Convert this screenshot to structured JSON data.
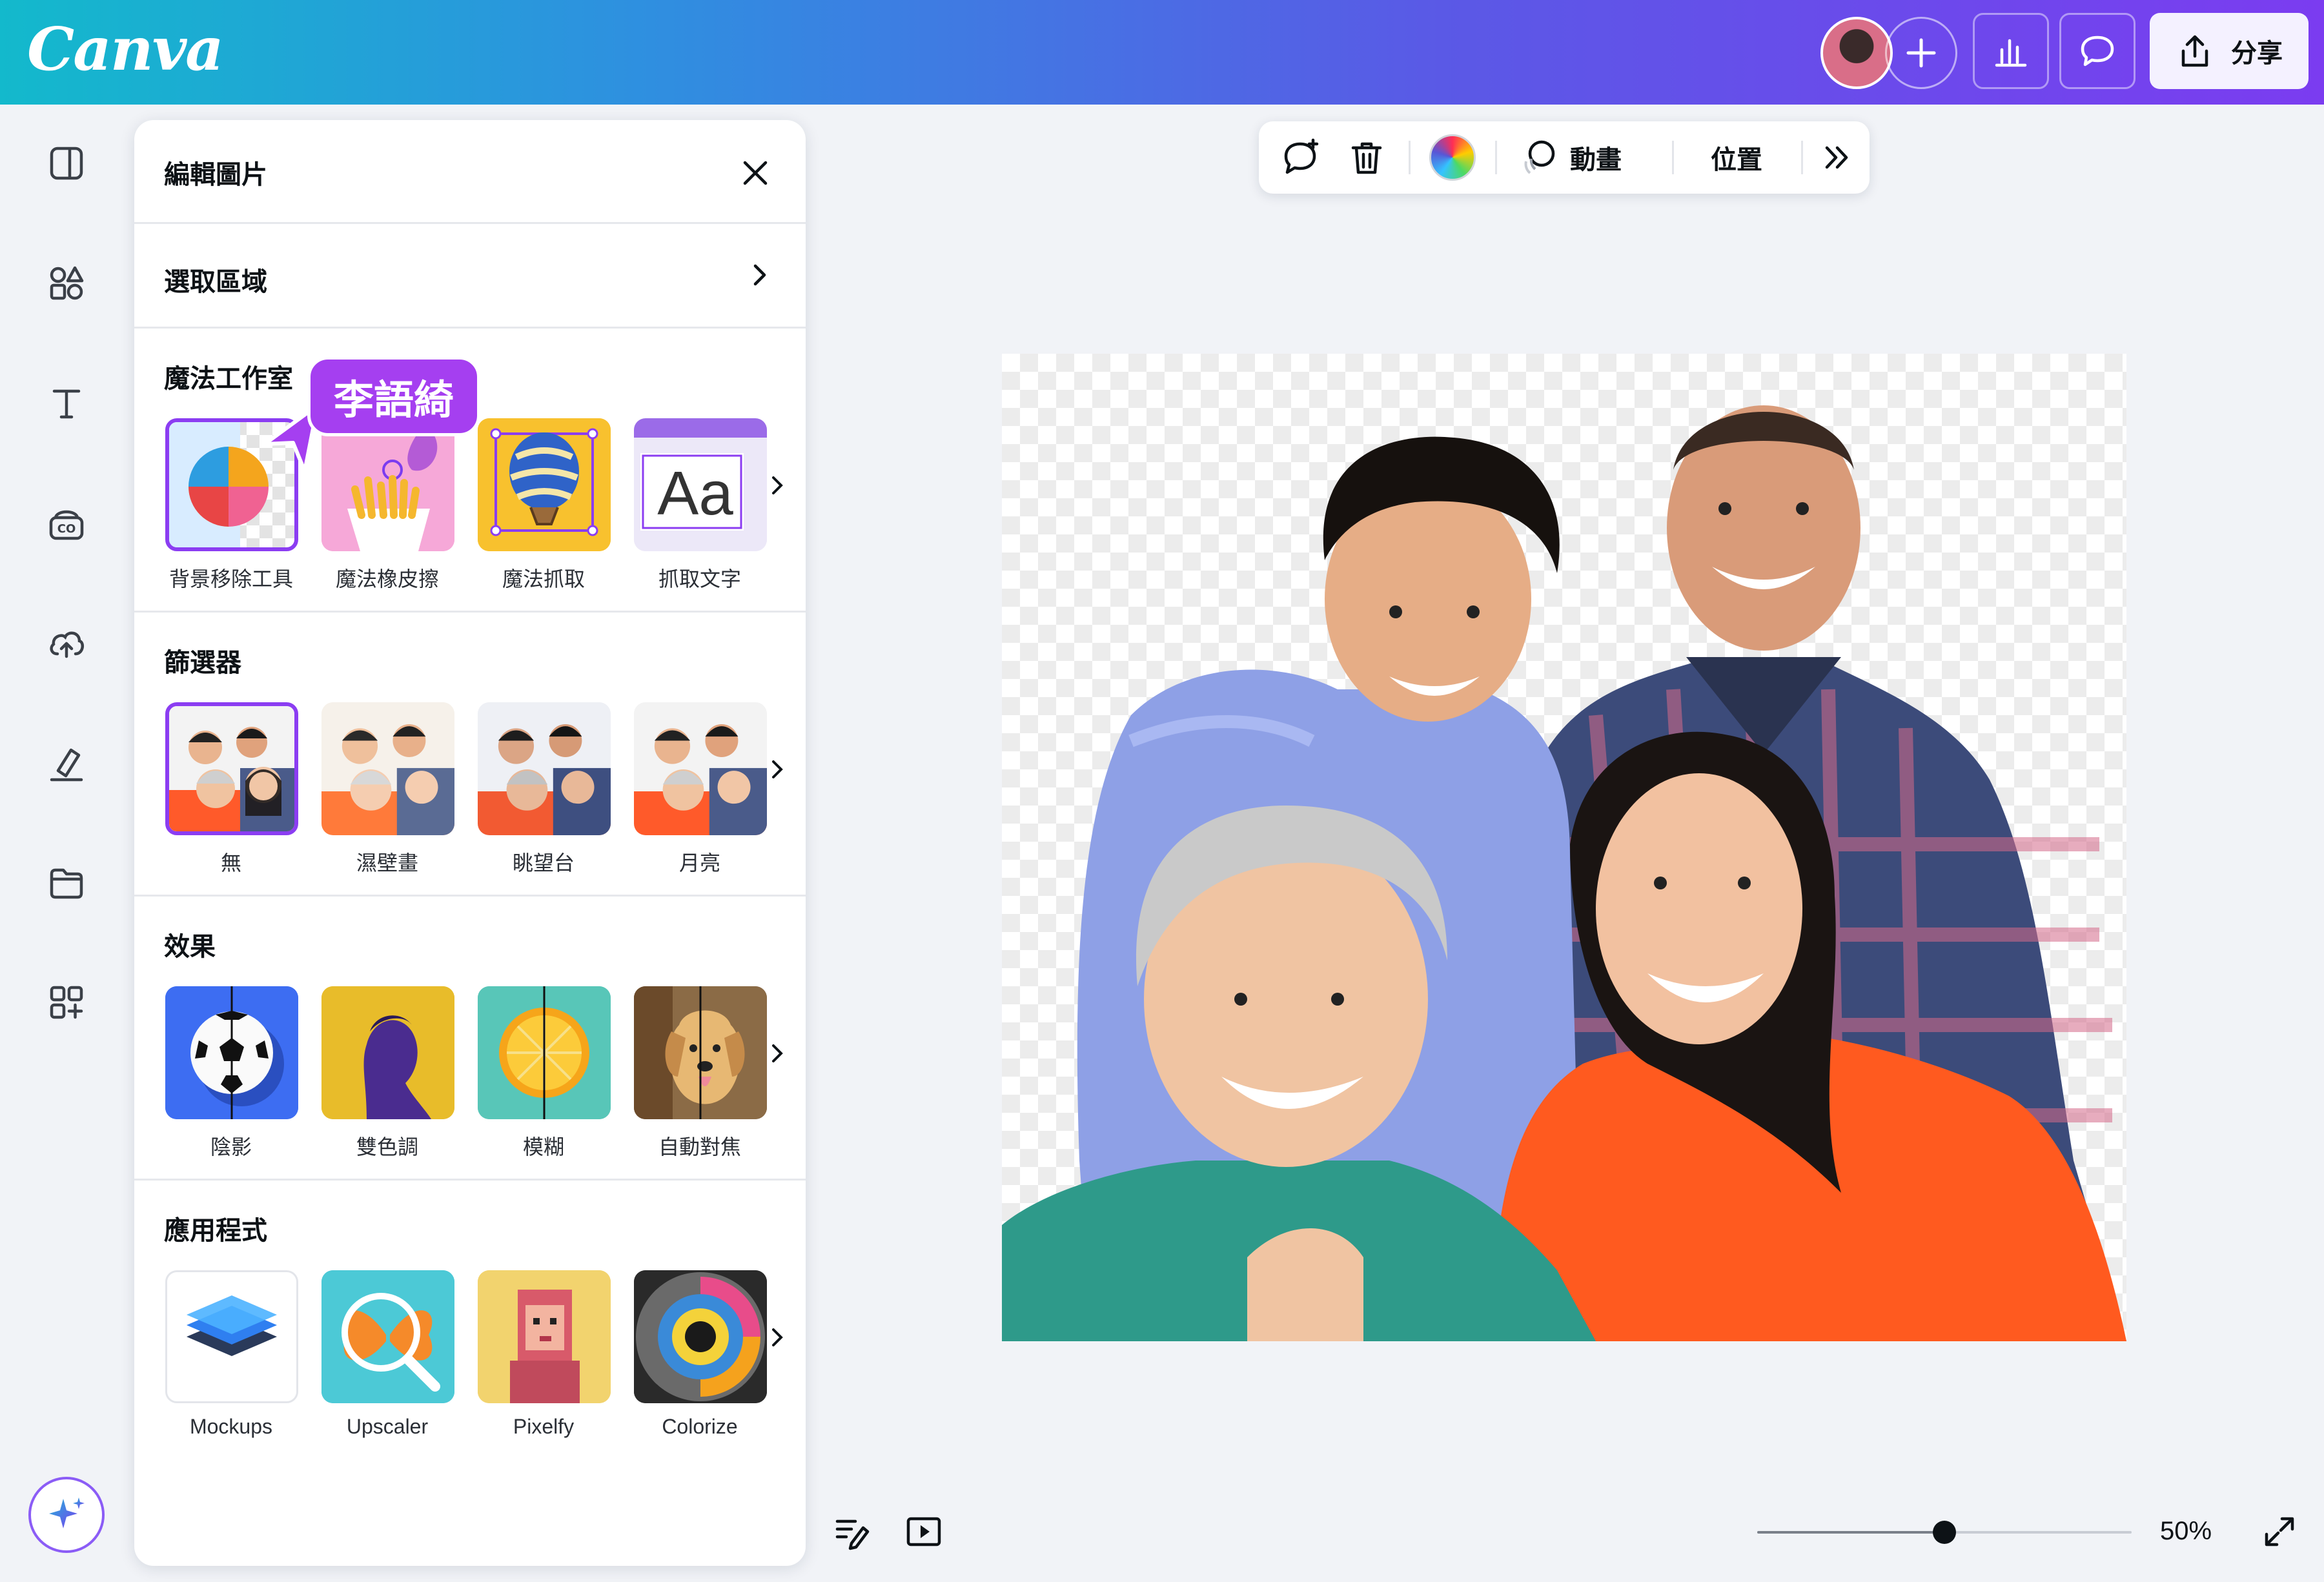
{
  "app": {
    "logo_text": "Canva"
  },
  "topbar": {
    "share_label": "分享",
    "colors": {
      "gradient_start": "#13b9cc",
      "gradient_end": "#7b3cf0"
    }
  },
  "left_rail": {
    "icons": [
      "layout-icon",
      "elements-icon",
      "text-icon",
      "brand-icon",
      "uploads-icon",
      "draw-icon",
      "projects-icon",
      "apps-icon",
      "magic-icon"
    ]
  },
  "panel": {
    "title": "編輯圖片",
    "selection_label": "選取區域",
    "sections": {
      "magic_studio": {
        "title": "魔法工作室",
        "items": [
          "背景移除工具",
          "魔法橡皮擦",
          "魔法抓取",
          "抓取文字"
        ]
      },
      "filters": {
        "title": "篩選器",
        "items": [
          "無",
          "濕壁畫",
          "眺望台",
          "月亮"
        ]
      },
      "effects": {
        "title": "效果",
        "items": [
          "陰影",
          "雙色調",
          "模糊",
          "自動對焦"
        ]
      },
      "apps": {
        "title": "應用程式",
        "items": [
          "Mockups",
          "Upscaler",
          "Pixelfy",
          "Colorize"
        ]
      }
    },
    "collaborator_tag": "李語綺",
    "tile_text_aa": "Aa"
  },
  "float_toolbar": {
    "animate_label": "動畫",
    "position_label": "位置"
  },
  "bottombar": {
    "zoom_percent": "50%",
    "zoom_level": 0.5
  },
  "accent_color": "#8b3df2"
}
